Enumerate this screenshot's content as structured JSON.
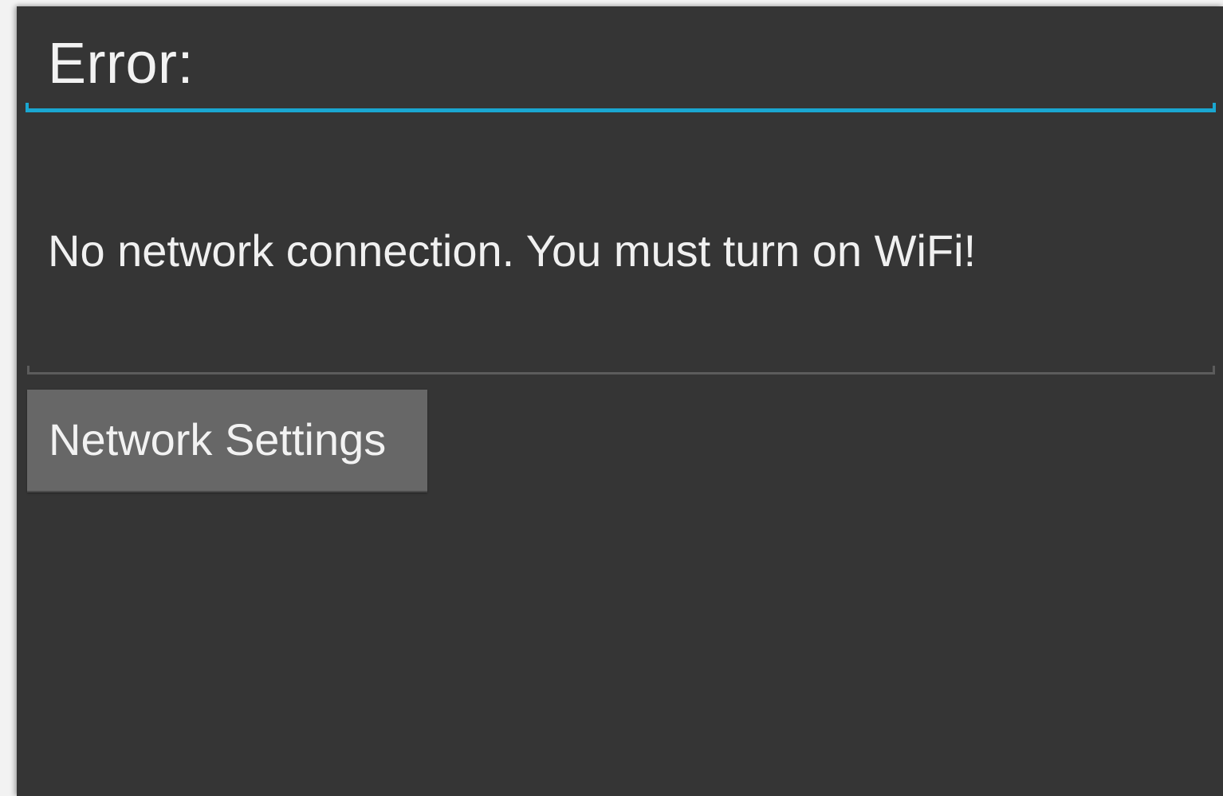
{
  "dialog": {
    "title": "Error:",
    "message": "No network connection. You must turn on WiFi!",
    "button_label": "Network Settings"
  },
  "colors": {
    "background": "#353535",
    "accent": "#1aa7d1",
    "button": "#676767",
    "text": "#f2f2f2"
  }
}
